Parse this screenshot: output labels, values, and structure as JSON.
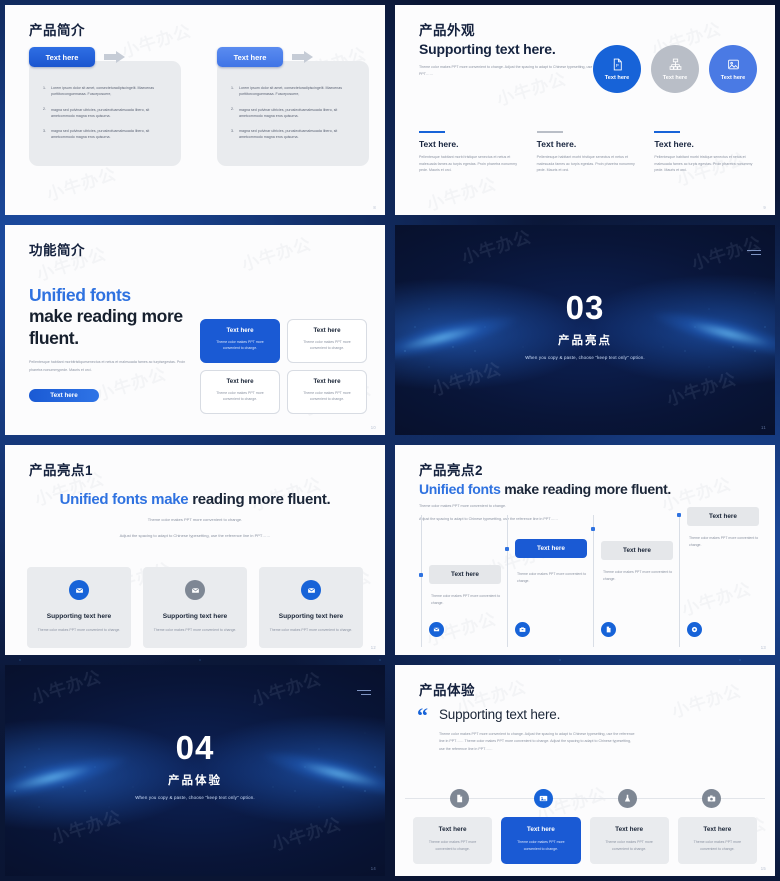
{
  "deck": {
    "background_color": "#0b1738",
    "accent_blue": "#1763d8",
    "accent_blue_light": "#4a7ae4",
    "grey": "#b9bec7",
    "panel_grey": "#e9ebee",
    "dark_navy": "#0a1533",
    "watermark_text": "小牛办公"
  },
  "slides": [
    {
      "id": "product-intro",
      "title": "产品简介",
      "page_number": "8",
      "columns": [
        {
          "button_label": "Text here",
          "items": [
            {
              "num": "1.",
              "text": "Lorem ipsum dolor sit amet, consecteturadipiscingelit. Maecenas porttitorconguemassa. Fusceposuere,"
            },
            {
              "num": "2.",
              "text": "magna sed pulvinar ultricies, purusleofuamalesuada libero, sit ametcommodo magna eros quisurna."
            },
            {
              "num": "3.",
              "text": "magna sed pulvinar ultricies, purusleofuamalesuada libero, sit ametcommodo magna eros quisurna."
            }
          ]
        },
        {
          "button_label": "Text here",
          "items": [
            {
              "num": "1.",
              "text": "Lorem ipsum dolor sit amet, consecteturadipiscingelit. Maecenas porttitorconguemassa. Fusceposuere,"
            },
            {
              "num": "2.",
              "text": "magna sed pulvinar ultricies, purusleofuamalesuada libero, sit ametcommodo magna eros quisurna."
            },
            {
              "num": "3.",
              "text": "magna sed pulvinar ultricies, purusleofuamalesuada libero, sit ametcommodo magna eros quisurna."
            }
          ]
        }
      ]
    },
    {
      "id": "product-appearance",
      "title": "产品外观",
      "page_number": "9",
      "headline": "Supporting text here.",
      "subtext": "Theme color makes PPT more convenient to change. Adjust the spacing to adapt to Chinese typesetting, use the reference line in PPT……",
      "circles": [
        {
          "label": "Text here",
          "icon": "presentation-file-icon",
          "color": "#1763d8"
        },
        {
          "label": "Text here",
          "icon": "org-chart-icon",
          "color": "#b9bec7"
        },
        {
          "label": "Text here",
          "icon": "image-icon",
          "color": "#4a7ae4"
        }
      ],
      "columns": [
        {
          "heading": "Text here.",
          "body": "Pellentesque habitant morbi tristique senectus et netus et malesuada fames ac turpis egestas. Proin pharetra nonummy pede. Mauris et orci.",
          "rule_color": "#1763d8"
        },
        {
          "heading": "Text here.",
          "body": "Pellentesque habitant morbi tristique senectus et netus et malesuada fames ac turpis egestas. Proin pharetra nonummy pede. Mauris et orci.",
          "rule_color": "#b9bec7"
        },
        {
          "heading": "Text here.",
          "body": "Pellentesque habitant morbi tristique senectus et netus et malesuada fames ac turpis egestas. Proin pharetra nonummy pede. Mauris et orci.",
          "rule_color": "#1763d8"
        }
      ]
    },
    {
      "id": "feature-intro",
      "title": "功能简介",
      "page_number": "10",
      "headline_blue": "Unified fonts",
      "headline_rest": "make reading more fluent.",
      "body": "Pellentesque habitant morbitristiquesenectus et netus et malesuada fames ac turpisegestas. Proin pharetra nonummypede. Mauris et orci.",
      "cta_label": "Text here",
      "cards": [
        {
          "title": "Text here",
          "desc": "Theme color makes PPT more convenient to change.",
          "active": true
        },
        {
          "title": "Text here",
          "desc": "Theme color makes PPT more convenient to change.",
          "active": false
        },
        {
          "title": "Text here",
          "desc": "Theme color makes PPT more convenient to change.",
          "active": false
        },
        {
          "title": "Text here",
          "desc": "Theme color makes PPT more convenient to change.",
          "active": false
        }
      ]
    },
    {
      "id": "section-03",
      "number": "03",
      "title_cn": "产品亮点",
      "subtitle_en": "When you copy & paste, choose \"keep text only\" option.",
      "page_number": "11"
    },
    {
      "id": "highlight-1",
      "title": "产品亮点1",
      "page_number": "12",
      "headline_blue": "Unified fonts make",
      "headline_rest": "reading more fluent.",
      "sub_line_1": "Theme color makes PPT more convenient to change.",
      "sub_line_2": "Adjust the spacing to adapt to Chinese typesetting, use the reference line in PPT……",
      "cards": [
        {
          "title": "Supporting text here",
          "desc": "Theme color makes PPT more convenient to change.",
          "icon": "mail-icon",
          "icon_color": "#1763d8"
        },
        {
          "title": "Supporting text here",
          "desc": "Theme color makes PPT more convenient to change.",
          "icon": "mail-icon",
          "icon_color": "#7e8794"
        },
        {
          "title": "Supporting text here",
          "desc": "Theme color makes PPT more convenient to change.",
          "icon": "mail-icon",
          "icon_color": "#1763d8"
        }
      ]
    },
    {
      "id": "highlight-2",
      "title": "产品亮点2",
      "page_number": "13",
      "headline_blue": "Unified fonts",
      "headline_rest": "make reading more fluent.",
      "sub_line_1": "Theme color makes PPT more convenient to change.",
      "sub_line_2": "Adjust the spacing to adapt to Chinese typesetting, use the reference line in PPT……",
      "steps": [
        {
          "label": "Text here",
          "desc": "Theme color makes PPT more convenient to change.",
          "icon": "mail-icon",
          "active": false
        },
        {
          "label": "Text here",
          "desc": "Theme color makes PPT more convenient to change.",
          "icon": "briefcase-icon",
          "active": true
        },
        {
          "label": "Text here",
          "desc": "Theme color makes PPT more convenient to change.",
          "icon": "document-icon",
          "active": false
        },
        {
          "label": "Text here",
          "desc": "Theme color makes PPT more convenient to change.",
          "icon": "location-pin-icon",
          "active": false
        }
      ]
    },
    {
      "id": "section-04",
      "number": "04",
      "title_cn": "产品体验",
      "subtitle_en": "When you copy & paste, choose \"keep text only\" option.",
      "page_number": "14"
    },
    {
      "id": "product-experience",
      "title": "产品体验",
      "page_number": "15",
      "quote_mark": "“",
      "headline": "Supporting text here.",
      "body": "Theme color makes PPT more convenient to change. Adjust the spacing to adapt to Chinese typesetting, use the reference line in PPT…… Theme color makes PPT more convenient to change. Adjust the spacing to adapt to Chinese typesetting, use the reference line in PPT……",
      "items": [
        {
          "title": "Text here",
          "desc": "Theme color makes PPT more convenient to change.",
          "icon": "document-icon",
          "active": false
        },
        {
          "title": "Text here",
          "desc": "Theme color makes PPT more convenient to change.",
          "icon": "image-icon",
          "active": true
        },
        {
          "title": "Text here",
          "desc": "Theme color makes PPT more convenient to change.",
          "icon": "flask-icon",
          "active": false
        },
        {
          "title": "Text here",
          "desc": "Theme color makes PPT more convenient to change.",
          "icon": "camera-icon",
          "active": false
        }
      ]
    }
  ]
}
